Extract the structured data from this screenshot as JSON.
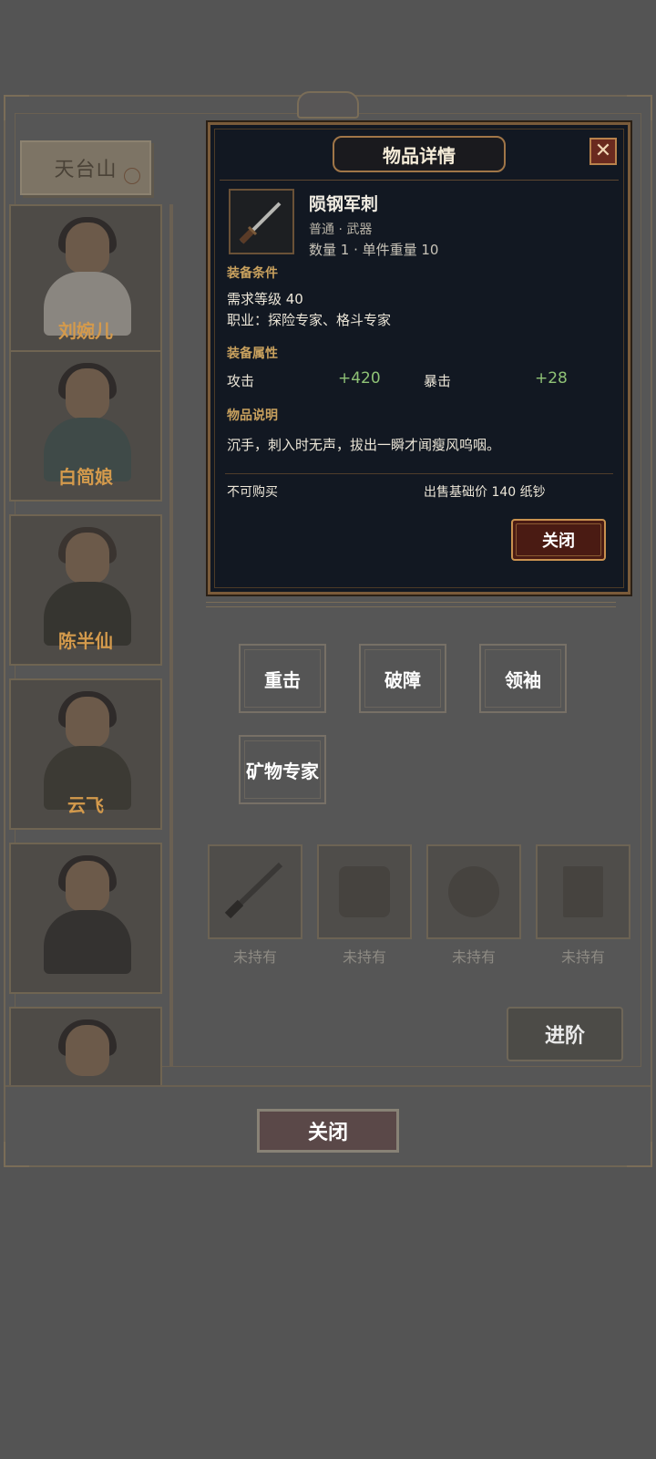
{
  "location": {
    "name": "天台山"
  },
  "characters": [
    {
      "name": "刘婉儿"
    },
    {
      "name": "白简娘"
    },
    {
      "name": "陈半仙"
    },
    {
      "name": "云飞"
    },
    {
      "name": ""
    },
    {
      "name": ""
    }
  ],
  "skills": [
    "重击",
    "破障",
    "领袖",
    "矿物专家"
  ],
  "equipment_slots": [
    {
      "status": "未持有"
    },
    {
      "status": "未持有"
    },
    {
      "status": "未持有"
    },
    {
      "status": "未持有"
    }
  ],
  "advance_label": "进阶",
  "close_label": "关闭",
  "modal": {
    "title": "物品详情",
    "close_icon": "close-x-icon",
    "item": {
      "name": "陨钢军刺",
      "type": "普通 · 武器",
      "quantity_weight": "数量 1 · 单件重量 10"
    },
    "requirements": {
      "label": "装备条件",
      "level": "需求等级 40",
      "profession": "职业：探险专家、格斗专家"
    },
    "attributes": {
      "label": "装备属性",
      "list": [
        {
          "name": "攻击",
          "value": "+420"
        },
        {
          "name": "暴击",
          "value": "+28"
        }
      ]
    },
    "description": {
      "label": "物品说明",
      "text": "沉手，刺入时无声，拔出一瞬才闻瘦风呜咽。"
    },
    "purchase_status": "不可购买",
    "sell_price": "出售基础价 140 纸钞",
    "close_button": "关闭"
  },
  "colors": {
    "modal_bg": "#121822",
    "accent_gold": "#c9a15e",
    "stat_green": "#8fc276",
    "name_orange": "#d49a4c"
  }
}
